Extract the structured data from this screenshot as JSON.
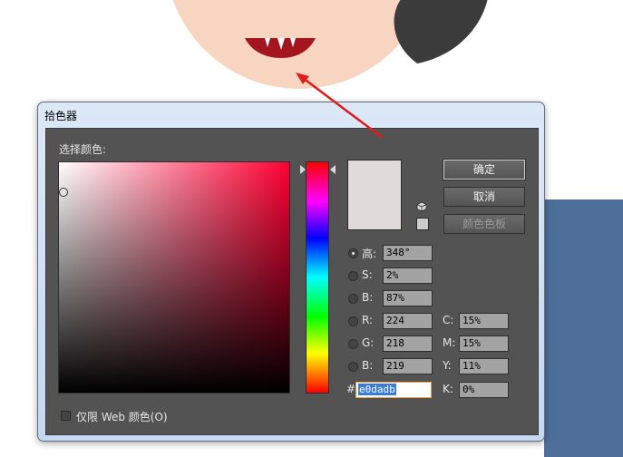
{
  "dialog": {
    "title": "拾色器",
    "field_label": "选择颜色:",
    "buttons": {
      "ok": "确定",
      "cancel": "取消",
      "swatches": "颜色色板"
    },
    "hsb": {
      "h_label": "高:",
      "h_value": "348°",
      "s_label": "S:",
      "s_value": "2%",
      "b_label": "B:",
      "b_value": "87%"
    },
    "rgb": {
      "r_label": "R:",
      "r_value": "224",
      "g_label": "G:",
      "g_value": "218",
      "b_label": "B:",
      "b_value": "219"
    },
    "cmyk": {
      "c_label": "C:",
      "c_value": "15%",
      "m_label": "M:",
      "m_value": "15%",
      "y_label": "Y:",
      "y_value": "11%",
      "k_label": "K:",
      "k_value": "0%"
    },
    "hex_label": "#",
    "hex_value": "e0dadb",
    "web_only_label": "仅限 Web 颜色(O)",
    "web_only_checked": false,
    "selected_mode": "hue"
  },
  "colors": {
    "current_color": "#e0dadb",
    "pure_hue": "#ff0033",
    "skin": "#f8d5c1",
    "mouth": "#a3161f",
    "hair": "#3b3b3b",
    "arrow": "#e11b1b"
  },
  "icons": {
    "websafe_warning": "cube-icon",
    "web_swatch": "square-swatch"
  }
}
